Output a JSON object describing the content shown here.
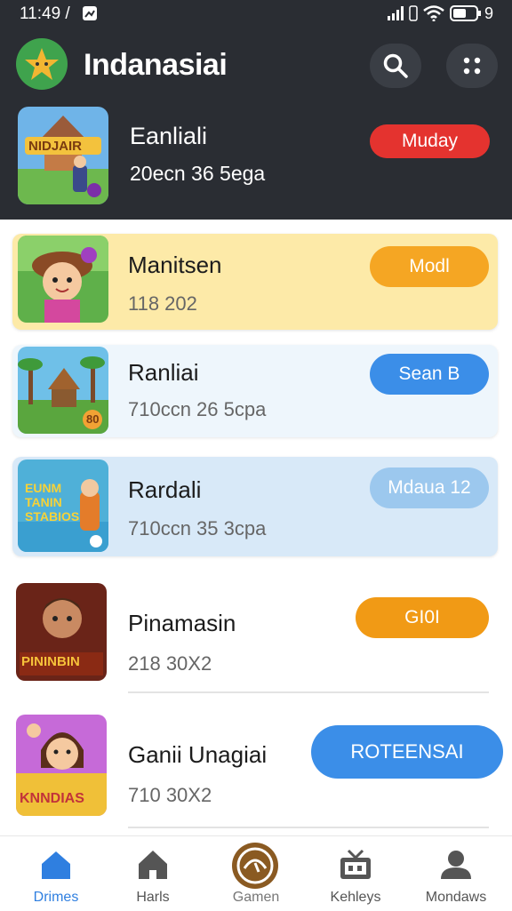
{
  "status_bar": {
    "time": "11:49 /",
    "battery": "9"
  },
  "app": {
    "title": "Indanasiai"
  },
  "featured": {
    "title": "Eanliali",
    "subtitle": "20ecn 36 5ega",
    "button": "Muday",
    "thumb_text": "NIDJAIR"
  },
  "games": [
    {
      "title": "Manitsen",
      "subtitle": "118 202",
      "button": "Modl"
    },
    {
      "title": "Ranliai",
      "subtitle": "710ccn 26 5cpa",
      "button": "Sean B",
      "badge": "80"
    },
    {
      "title": "Rardali",
      "subtitle": "710ccn 35 3cpa",
      "button": "Mdaua 12",
      "thumb_text": "EUNM TANIN STABIOS"
    },
    {
      "title": "Pinamasin",
      "subtitle": "218 30X2",
      "button": "GI0I",
      "thumb_text": "PININBIN"
    },
    {
      "title": "Ganii Unagiai",
      "subtitle": "710 30X2",
      "button": "ROTEENSAI",
      "thumb_text": "KNNDIAS"
    }
  ],
  "nav": [
    {
      "label": "Drimes"
    },
    {
      "label": "Harls"
    },
    {
      "label": "Gamen"
    },
    {
      "label": "Kehleys"
    },
    {
      "label": "Mondaws"
    }
  ],
  "colors": {
    "header_bg": "#2a2d33",
    "red": "#e4332f",
    "orange": "#f5a623",
    "blue": "#3b8ee8",
    "light_blue": "#9cc8ee",
    "yellow_card": "#fdeaa8",
    "active_nav": "#2f7fe0"
  }
}
